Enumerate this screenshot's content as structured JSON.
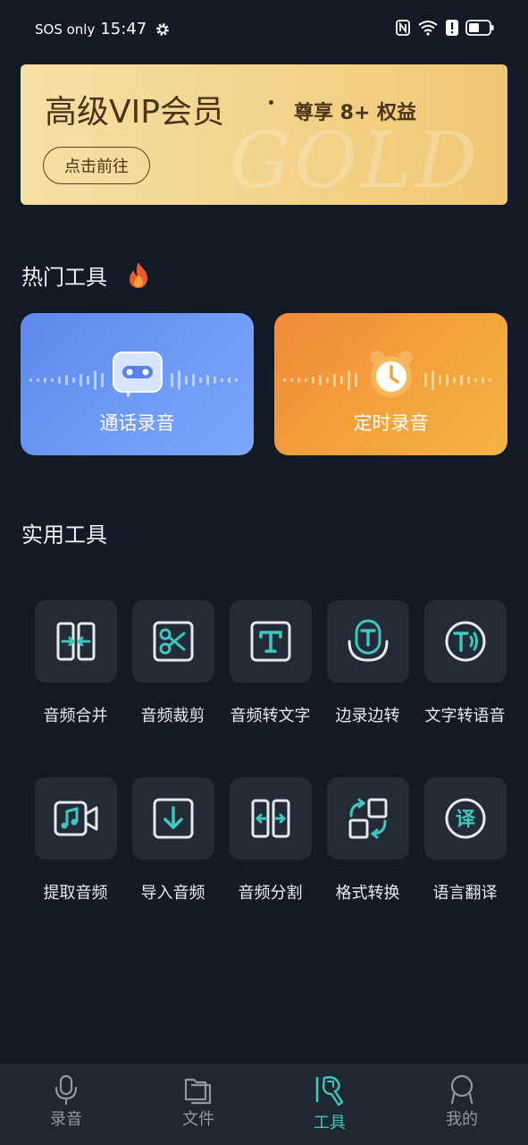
{
  "status_bar": {
    "sos": "SOS only",
    "time": "15:47",
    "icons": [
      "gear-icon",
      "nfc-icon",
      "wifi-icon",
      "alert-icon",
      "battery-icon"
    ]
  },
  "vip_banner": {
    "title": "高级VIP会员",
    "benefits": "尊享 8+ 权益",
    "button": "点击前往",
    "watermark": "GOLD"
  },
  "hot_tools": {
    "title": "热门工具",
    "items": [
      {
        "label": "通话录音",
        "icon": "phone-record-icon"
      },
      {
        "label": "定时录音",
        "icon": "alarm-clock-icon"
      }
    ]
  },
  "utility_tools": {
    "title": "实用工具",
    "items": [
      {
        "label": "音频合并",
        "icon": "merge-icon"
      },
      {
        "label": "音频裁剪",
        "icon": "scissors-icon"
      },
      {
        "label": "音频转文字",
        "icon": "text-t-icon"
      },
      {
        "label": "边录边转",
        "icon": "mic-text-icon"
      },
      {
        "label": "文字转语音",
        "icon": "text-to-speech-icon"
      },
      {
        "label": "提取音频",
        "icon": "video-music-icon"
      },
      {
        "label": "导入音频",
        "icon": "download-box-icon"
      },
      {
        "label": "音频分割",
        "icon": "split-icon"
      },
      {
        "label": "格式转换",
        "icon": "convert-icon"
      },
      {
        "label": "语言翻译",
        "icon": "translate-icon"
      }
    ]
  },
  "bottom_nav": {
    "items": [
      {
        "label": "录音",
        "icon": "mic-icon"
      },
      {
        "label": "文件",
        "icon": "folder-icon"
      },
      {
        "label": "工具",
        "icon": "tools-icon",
        "active": true
      },
      {
        "label": "我的",
        "icon": "profile-icon"
      }
    ]
  },
  "colors": {
    "background": "#111a25",
    "accent": "#3fc7be",
    "tile": "#232b37",
    "nav": "#1f2731"
  }
}
